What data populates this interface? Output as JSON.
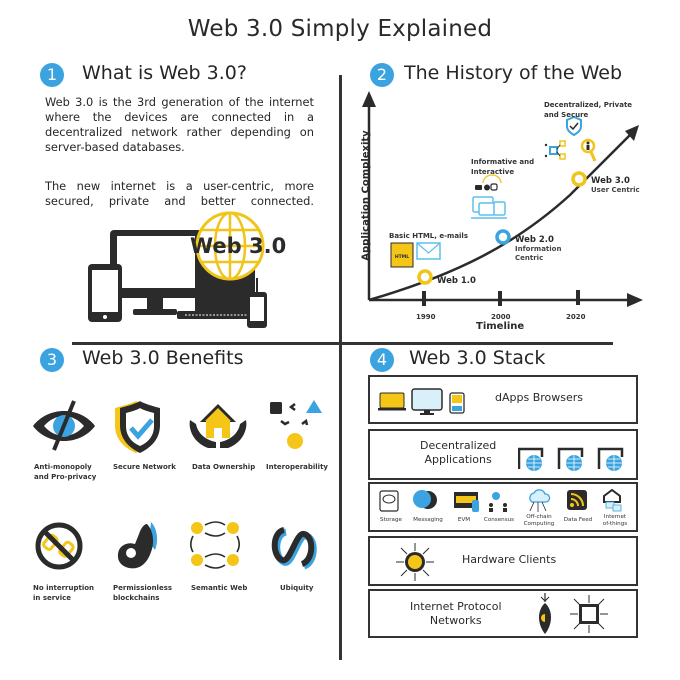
{
  "title": "Web 3.0 Simply Explained",
  "colors": {
    "accent_blue": "#3aa3e0",
    "accent_yellow": "#f5c518",
    "dark": "#2b2b2b",
    "light_blue": "#5bc0eb"
  },
  "sections": {
    "what": {
      "number": "1",
      "title": "What is Web 3.0?",
      "paragraph1_lines": [
        "Web 3.0 is the 3rd generation of the internet",
        "where the devices are connected in a",
        "decentralized network rather depending on",
        "server-based databases."
      ],
      "paragraph2_lines": [
        "The new internet is a user-centric, more",
        "secured, private and better connected."
      ],
      "illustration_label": "Web 3.0"
    },
    "history": {
      "number": "2",
      "title": "The History of the Web",
      "y_axis_label": "Application Complexity",
      "x_axis_label": "Timeline",
      "ticks": [
        "1990",
        "2000",
        "2020"
      ],
      "eras": [
        {
          "name": "Web 1.0",
          "subtitle": "",
          "caption": "Basic HTML, e-mails",
          "icon": "html-mail-icon"
        },
        {
          "name": "Web 2.0",
          "subtitle_lines": [
            "Information",
            "Centric"
          ],
          "caption_lines": [
            "Informative and",
            "Interactive"
          ],
          "icon": "devices-social-icon"
        },
        {
          "name": "Web 3.0",
          "subtitle_lines": [
            "User Centric"
          ],
          "caption_lines": [
            "Decentralized, Private",
            "and Secure"
          ],
          "icon": "shield-network-icon"
        }
      ],
      "html_icon_text": "HTML"
    },
    "benefits": {
      "number": "3",
      "title": "Web 3.0 Benefits",
      "items": [
        {
          "label_lines": [
            "Anti-monopoly",
            "and Pro-privacy"
          ],
          "icon": "eye-slash-icon"
        },
        {
          "label_lines": [
            "Secure Network"
          ],
          "icon": "shield-check-icon"
        },
        {
          "label_lines": [
            "Data Ownership"
          ],
          "icon": "house-hands-icon"
        },
        {
          "label_lines": [
            "Interoperability"
          ],
          "icon": "shapes-icon"
        },
        {
          "label_lines": [
            "No interruption",
            "in service"
          ],
          "icon": "broken-chain-icon"
        },
        {
          "label_lines": [
            "Permissionless",
            "blockchains"
          ],
          "icon": "ok-hand-icon"
        },
        {
          "label_lines": [
            "Semantic Web"
          ],
          "icon": "linked-nodes-icon"
        },
        {
          "label_lines": [
            "Ubiquity"
          ],
          "icon": "infinity-icon"
        }
      ]
    },
    "stack": {
      "number": "4",
      "title": "Web 3.0 Stack",
      "layers": [
        {
          "label_lines": [
            "dApps Browsers"
          ]
        },
        {
          "label_lines": [
            "Decentralized",
            "Applications"
          ]
        },
        {
          "items": [
            {
              "label_lines": [
                "Storage"
              ]
            },
            {
              "label_lines": [
                "Messaging"
              ]
            },
            {
              "label_lines": [
                "EVM"
              ]
            },
            {
              "label_lines": [
                "Consensus"
              ]
            },
            {
              "label_lines": [
                "Off-chain",
                "Computing"
              ]
            },
            {
              "label_lines": [
                "Data Feed"
              ]
            },
            {
              "label_lines": [
                "Internet",
                "of-things"
              ]
            }
          ]
        },
        {
          "label_lines": [
            "Hardware Clients"
          ]
        },
        {
          "label_lines": [
            "Internet Protocol",
            "Networks"
          ]
        }
      ]
    }
  }
}
